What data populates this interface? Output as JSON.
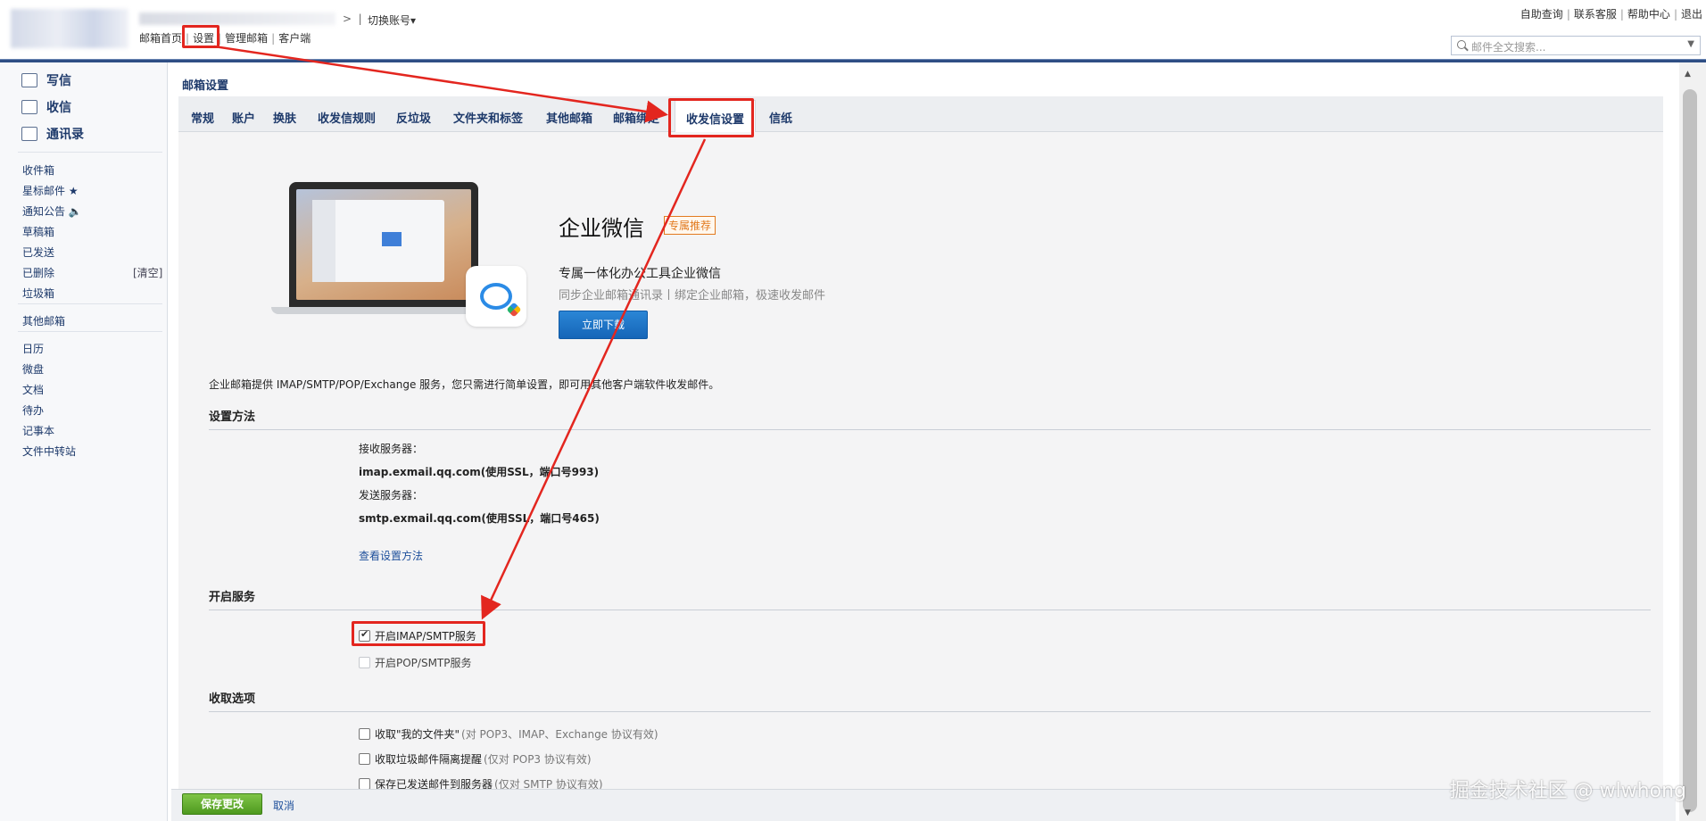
{
  "header": {
    "switch_account": "切换账号▾",
    "links": [
      "邮箱首页",
      "设置",
      "管理邮箱",
      "客户端"
    ],
    "right_links": [
      "自助查询",
      "联系客服",
      "帮助中心",
      "退出"
    ],
    "search_placeholder": "邮件全文搜索..."
  },
  "sidebar": {
    "primary": [
      {
        "label": "写信",
        "icon": "compose-icon"
      },
      {
        "label": "收信",
        "icon": "inbox-icon"
      },
      {
        "label": "通讯录",
        "icon": "contacts-icon"
      }
    ],
    "folders": [
      "收件箱",
      "星标邮件 ★",
      "通知公告 🔈",
      "草稿箱",
      "已发送",
      "已删除",
      "垃圾箱"
    ],
    "clear_label": "[清空]",
    "other_mail": "其他邮箱",
    "apps": [
      "日历",
      "微盘",
      "文档",
      "待办",
      "记事本",
      "文件中转站"
    ]
  },
  "main": {
    "title": "邮箱设置",
    "tabs": [
      "常规",
      "账户",
      "换肤",
      "收发信规则",
      "反垃圾",
      "文件夹和标签",
      "其他邮箱",
      "邮箱绑定",
      "收发信设置",
      "信纸"
    ],
    "active_tab": "收发信设置"
  },
  "promo": {
    "title": "企业微信",
    "badge": "专属推荐",
    "subtitle": "专属一体化办公工具企业微信",
    "description": "同步企业邮箱通讯录丨绑定企业邮箱，极速收发邮件",
    "button": "立即下载"
  },
  "intro": "企业邮箱提供 IMAP/SMTP/POP/Exchange 服务，您只需进行简单设置，即可用其他客户端软件收发邮件。",
  "setup": {
    "heading": "设置方法",
    "incoming_label": "接收服务器：",
    "incoming_value": "imap.exmail.qq.com(使用SSL，端口号993)",
    "outgoing_label": "发送服务器：",
    "outgoing_value": "smtp.exmail.qq.com(使用SSL，端口号465)",
    "link": "查看设置方法"
  },
  "services": {
    "heading": "开启服务",
    "items": [
      {
        "label": "开启IMAP/SMTP服务",
        "checked": true
      },
      {
        "label": "开启POP/SMTP服务",
        "checked": false
      }
    ]
  },
  "fetch": {
    "heading": "收取选项",
    "items": [
      {
        "label": "收取\"我的文件夹\"",
        "note": "(对 POP3、IMAP、Exchange 协议有效)"
      },
      {
        "label": "收取垃圾邮件隔离提醒",
        "note": "(仅对 POP3 协议有效)"
      },
      {
        "label": "保存已发送邮件到服务器",
        "note": "(仅对 SMTP 协议有效)"
      }
    ]
  },
  "footer": {
    "save": "保存更改",
    "cancel": "取消"
  },
  "watermark": "掘金技术社区 @ wlwhong",
  "colors": {
    "accent": "#2e4e84",
    "highlight": "#e3261f",
    "save": "#5aa82a"
  }
}
